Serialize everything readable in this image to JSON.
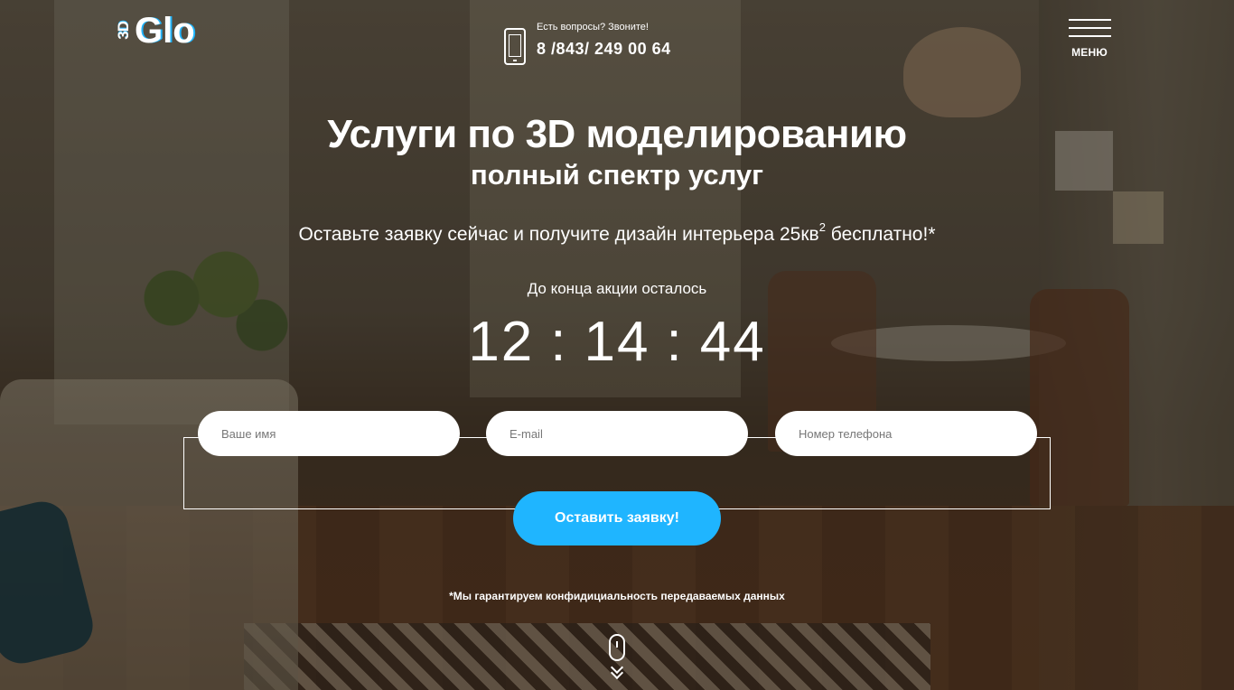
{
  "logo": {
    "mark": "3D",
    "word": "Glo"
  },
  "header": {
    "contact_label": "Есть вопросы? Звоните!",
    "phone": "8 /843/ 249 00 64",
    "menu_label": "МЕНЮ"
  },
  "hero": {
    "title": "Услуги по 3D моделированию",
    "subtitle": "полный спектр услуг",
    "offer_before": "Оставьте заявку сейчас и получите дизайн интерьера 25кв",
    "offer_sup": "2",
    "offer_after": " бесплатно!*",
    "countdown_label": "До конца акции осталось",
    "timer": {
      "hours": "12",
      "minutes": "14",
      "seconds": "44",
      "separator": ":"
    }
  },
  "form": {
    "name_placeholder": "Ваше имя",
    "email_placeholder": "E-mail",
    "phone_placeholder": "Номер телефона",
    "submit_label": "Оставить заявку!",
    "privacy_note": "*Мы гарантируем конфидициальность передаваемых данных"
  },
  "colors": {
    "accent": "#1fb5ff",
    "text": "#ffffff",
    "field_bg": "#ffffff"
  },
  "icons": {
    "phone": "phone-icon",
    "menu": "hamburger-icon",
    "scroll": "mouse-scroll-icon"
  }
}
